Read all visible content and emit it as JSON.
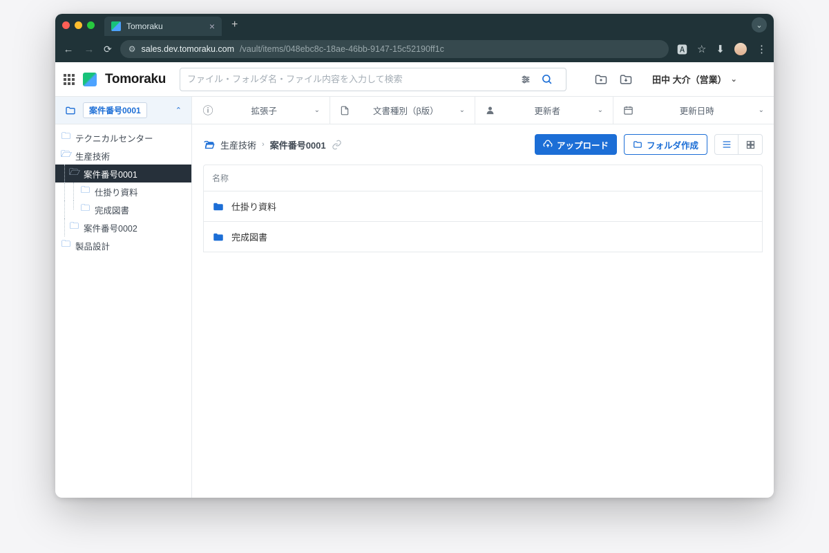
{
  "browser": {
    "tab_title": "Tomoraku",
    "url_site": "sales.dev.tomoraku.com",
    "url_path": "/vault/items/048ebc8c-18ae-46bb-9147-15c52190ff1c"
  },
  "header": {
    "brand": "Tomoraku",
    "search_placeholder": "ファイル・フォルダ名・ファイル内容を入力して検索",
    "user_label": "田中 大介（営業）"
  },
  "filters": {
    "folder_selected": "案件番号0001",
    "extension": "拡張子",
    "doc_type": "文書種別（β版）",
    "updater": "更新者",
    "updated_at": "更新日時"
  },
  "sidebar": {
    "items": [
      {
        "label": "テクニカルセンター",
        "lvl": 0
      },
      {
        "label": "生産技術",
        "lvl": 0,
        "open": true
      },
      {
        "label": "案件番号0001",
        "lvl": 1,
        "open": true,
        "active": true
      },
      {
        "label": "仕掛り資料",
        "lvl": 2
      },
      {
        "label": "完成図書",
        "lvl": 2
      },
      {
        "label": "案件番号0002",
        "lvl": 1
      },
      {
        "label": "製品設計",
        "lvl": 0
      }
    ]
  },
  "breadcrumb": {
    "parent": "生産技術",
    "current": "案件番号0001"
  },
  "actions": {
    "upload": "アップロード",
    "new_folder": "フォルダ作成"
  },
  "list": {
    "header_label": "名称",
    "rows": [
      {
        "name": "仕掛り資料"
      },
      {
        "name": "完成図書"
      }
    ]
  }
}
